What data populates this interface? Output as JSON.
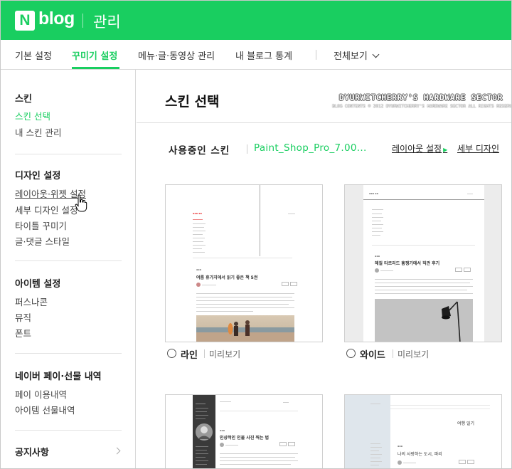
{
  "header": {
    "logo_letter": "N",
    "logo_text": "blog",
    "section": "관리"
  },
  "tabs": [
    {
      "label": "기본 설정",
      "active": false
    },
    {
      "label": "꾸미기 설정",
      "active": true
    },
    {
      "label": "메뉴·글·동영상 관리",
      "active": false
    },
    {
      "label": "내 블로그 통계",
      "active": false
    },
    {
      "label": "전체보기",
      "active": false
    }
  ],
  "sidebar": {
    "skin": {
      "heading": "스킨",
      "items": [
        "스킨 선택",
        "내 스킨 관리"
      ]
    },
    "design": {
      "heading": "디자인 설정",
      "items": [
        "레이아웃·위젯 설정",
        "세부 디자인 설정",
        "타이틀 꾸미기",
        "글·댓글 스타일"
      ]
    },
    "items": {
      "heading": "아이템 설정",
      "items": [
        "퍼스나콘",
        "뮤직",
        "폰트"
      ]
    },
    "pay": {
      "heading": "네이버 페이·선물 내역",
      "items": [
        "페이 이용내역",
        "아이템 선물내역"
      ]
    },
    "notice": {
      "heading": "공지사항"
    }
  },
  "main": {
    "title": "스킨 선택",
    "watermark_title": "DYURWITCHERRY'S HARDWARE SECTOR",
    "watermark_sub": "BLOG CONTENTS © 2012 DYURWITCHERRY'S HARDWARE SECTOR ALL RIGHTS RESERVED.",
    "current_label": "사용중인 스킨",
    "current_name": "Paint_Shop_Pro_7.00...",
    "layout_link": "레이아웃 설정",
    "detail_link": "세부 디자인",
    "preview_label": "미리보기",
    "skins": [
      {
        "name": "라인",
        "post_title": "여름 휴가지에서 읽기 좋은 책 5권"
      },
      {
        "name": "와이드",
        "post_title": "해질 타르리드 훔쟁기에서 직관 후기"
      },
      {
        "name": "",
        "post_title": "인상적인 인물 사진 찍는 법"
      },
      {
        "name": "",
        "post_title": "나의 사랑하는 도시, 파리",
        "side_title": "여행 일기"
      }
    ]
  },
  "colors": {
    "brand": "#19ce60",
    "text": "#222222",
    "border": "#d8d8d8"
  }
}
